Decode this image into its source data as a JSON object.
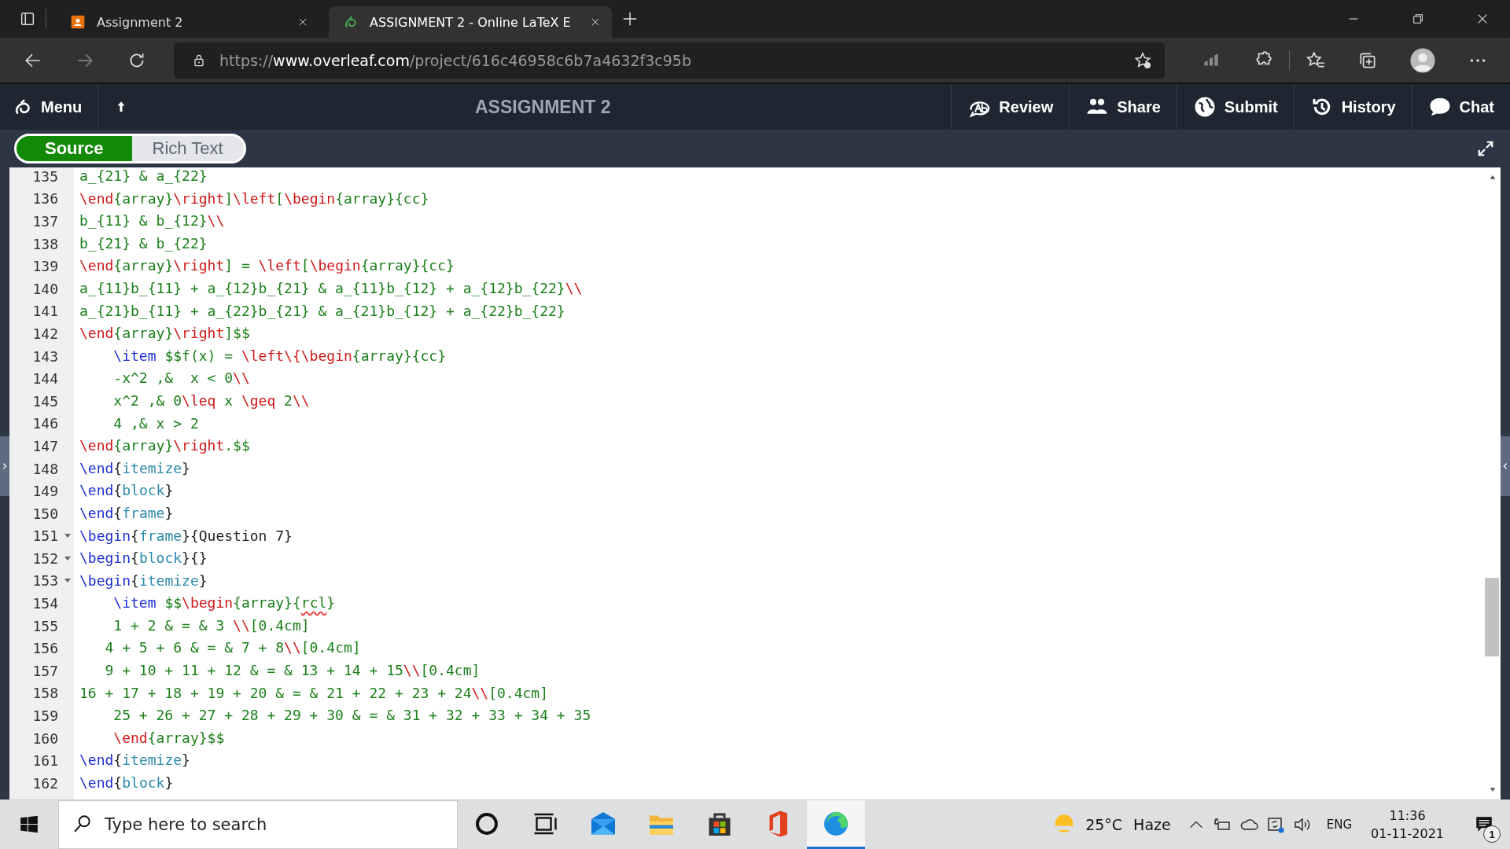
{
  "browser": {
    "tabs": [
      {
        "title": "Assignment 2",
        "kind": "classroom",
        "selected": false
      },
      {
        "title": "ASSIGNMENT 2 - Online LaTeX E",
        "kind": "overleaf",
        "selected": true
      }
    ],
    "url": {
      "scheme": "https://",
      "domain": "www.overleaf.com",
      "path": "/project/616c46958c6b7a4632f3c95b"
    }
  },
  "toolbar": {
    "menu": "Menu",
    "title": "ASSIGNMENT 2",
    "actions": [
      {
        "label": "Review",
        "kind": "review"
      },
      {
        "label": "Share",
        "kind": "share"
      },
      {
        "label": "Submit",
        "kind": "submit"
      },
      {
        "label": "History",
        "kind": "history"
      },
      {
        "label": "Chat",
        "kind": "chat"
      }
    ]
  },
  "editor_modes": [
    {
      "label": "Source",
      "selected": true
    },
    {
      "label": "Rich Text",
      "selected": false
    }
  ],
  "code_lines": [
    {
      "number": "135",
      "fold": false,
      "tokens": [
        {
          "kind": "math",
          "text": "a_{21} & a_{22}"
        }
      ]
    },
    {
      "number": "136",
      "fold": false,
      "tokens": [
        {
          "kind": "cmd",
          "text": "\\end"
        },
        {
          "kind": "math",
          "text": "{array}"
        },
        {
          "kind": "cmd",
          "text": "\\right"
        },
        {
          "kind": "math",
          "text": "]"
        },
        {
          "kind": "cmd",
          "text": "\\left"
        },
        {
          "kind": "math",
          "text": "["
        },
        {
          "kind": "cmd",
          "text": "\\begin"
        },
        {
          "kind": "math",
          "text": "{array}{cc}"
        }
      ]
    },
    {
      "number": "137",
      "fold": false,
      "tokens": [
        {
          "kind": "math",
          "text": "b_{11} & b_{12}"
        },
        {
          "kind": "cmd",
          "text": "\\\\"
        }
      ]
    },
    {
      "number": "138",
      "fold": false,
      "tokens": [
        {
          "kind": "math",
          "text": "b_{21} & b_{22}"
        }
      ]
    },
    {
      "number": "139",
      "fold": false,
      "tokens": [
        {
          "kind": "cmd",
          "text": "\\end"
        },
        {
          "kind": "math",
          "text": "{array}"
        },
        {
          "kind": "cmd",
          "text": "\\right"
        },
        {
          "kind": "math",
          "text": "] = "
        },
        {
          "kind": "cmd",
          "text": "\\left"
        },
        {
          "kind": "math",
          "text": "["
        },
        {
          "kind": "cmd",
          "text": "\\begin"
        },
        {
          "kind": "math",
          "text": "{array}{cc}"
        }
      ]
    },
    {
      "number": "140",
      "fold": false,
      "tokens": [
        {
          "kind": "math",
          "text": "a_{11}b_{11} + a_{12}b_{21} & a_{11}b_{12} + a_{12}b_{22}"
        },
        {
          "kind": "cmd",
          "text": "\\\\"
        }
      ]
    },
    {
      "number": "141",
      "fold": false,
      "tokens": [
        {
          "kind": "math",
          "text": "a_{21}b_{11} + a_{22}b_{21} & a_{21}b_{12} + a_{22}b_{22}"
        }
      ]
    },
    {
      "number": "142",
      "fold": false,
      "tokens": [
        {
          "kind": "cmd",
          "text": "\\end"
        },
        {
          "kind": "math",
          "text": "{array}"
        },
        {
          "kind": "cmd",
          "text": "\\right"
        },
        {
          "kind": "math",
          "text": "]$$"
        }
      ]
    },
    {
      "number": "143",
      "fold": false,
      "tokens": [
        {
          "kind": "kw",
          "text": "    \\item"
        },
        {
          "kind": "math",
          "text": " $$f(x) = "
        },
        {
          "kind": "cmd",
          "text": "\\left\\{\\begin"
        },
        {
          "kind": "math",
          "text": "{array}{cc}"
        }
      ]
    },
    {
      "number": "144",
      "fold": false,
      "tokens": [
        {
          "kind": "math",
          "text": "    -x^2 ,&  x < 0"
        },
        {
          "kind": "cmd",
          "text": "\\\\"
        }
      ]
    },
    {
      "number": "145",
      "fold": false,
      "tokens": [
        {
          "kind": "math",
          "text": "    x^2 ,& 0"
        },
        {
          "kind": "cmd",
          "text": "\\leq"
        },
        {
          "kind": "math",
          "text": " x "
        },
        {
          "kind": "cmd",
          "text": "\\geq"
        },
        {
          "kind": "math",
          "text": " 2"
        },
        {
          "kind": "cmd",
          "text": "\\\\"
        }
      ]
    },
    {
      "number": "146",
      "fold": false,
      "tokens": [
        {
          "kind": "math",
          "text": "    4 ,& x > 2"
        }
      ]
    },
    {
      "number": "147",
      "fold": false,
      "tokens": [
        {
          "kind": "cmd",
          "text": "\\end"
        },
        {
          "kind": "math",
          "text": "{array}"
        },
        {
          "kind": "cmd",
          "text": "\\right"
        },
        {
          "kind": "math",
          "text": ".$$"
        }
      ]
    },
    {
      "number": "148",
      "fold": false,
      "tokens": [
        {
          "kind": "kw",
          "text": "\\end"
        },
        {
          "kind": "plain",
          "text": "{"
        },
        {
          "kind": "arg",
          "text": "itemize"
        },
        {
          "kind": "plain",
          "text": "}"
        }
      ]
    },
    {
      "number": "149",
      "fold": false,
      "tokens": [
        {
          "kind": "kw",
          "text": "\\end"
        },
        {
          "kind": "plain",
          "text": "{"
        },
        {
          "kind": "arg",
          "text": "block"
        },
        {
          "kind": "plain",
          "text": "}"
        }
      ]
    },
    {
      "number": "150",
      "fold": false,
      "tokens": [
        {
          "kind": "kw",
          "text": "\\end"
        },
        {
          "kind": "plain",
          "text": "{"
        },
        {
          "kind": "arg",
          "text": "frame"
        },
        {
          "kind": "plain",
          "text": "}"
        }
      ]
    },
    {
      "number": "151",
      "fold": true,
      "tokens": [
        {
          "kind": "kw",
          "text": "\\begin"
        },
        {
          "kind": "plain",
          "text": "{"
        },
        {
          "kind": "arg",
          "text": "frame"
        },
        {
          "kind": "plain",
          "text": "}{Question 7}"
        }
      ]
    },
    {
      "number": "152",
      "fold": true,
      "tokens": [
        {
          "kind": "kw",
          "text": "\\begin"
        },
        {
          "kind": "plain",
          "text": "{"
        },
        {
          "kind": "arg",
          "text": "block"
        },
        {
          "kind": "plain",
          "text": "}{}"
        }
      ]
    },
    {
      "number": "153",
      "fold": true,
      "tokens": [
        {
          "kind": "kw",
          "text": "\\begin"
        },
        {
          "kind": "plain",
          "text": "{"
        },
        {
          "kind": "arg",
          "text": "itemize"
        },
        {
          "kind": "plain",
          "text": "}"
        }
      ]
    },
    {
      "number": "154",
      "fold": false,
      "tokens": [
        {
          "kind": "kw",
          "text": "    \\item"
        },
        {
          "kind": "math",
          "text": " $$"
        },
        {
          "kind": "cmd",
          "text": "\\begin"
        },
        {
          "kind": "math",
          "text": "{array}{"
        },
        {
          "kind": "spell",
          "text": "rcl"
        },
        {
          "kind": "math",
          "text": "}"
        }
      ]
    },
    {
      "number": "155",
      "fold": false,
      "tokens": [
        {
          "kind": "math",
          "text": "    1 + 2 & = & 3 "
        },
        {
          "kind": "cmd",
          "text": "\\\\"
        },
        {
          "kind": "math",
          "text": "[0.4cm]"
        }
      ]
    },
    {
      "number": "156",
      "fold": false,
      "tokens": [
        {
          "kind": "math",
          "text": "   4 + 5 + 6 & = & 7 + 8"
        },
        {
          "kind": "cmd",
          "text": "\\\\"
        },
        {
          "kind": "math",
          "text": "[0.4cm]"
        }
      ]
    },
    {
      "number": "157",
      "fold": false,
      "tokens": [
        {
          "kind": "math",
          "text": "   9 + 10 + 11 + 12 & = & 13 + 14 + 15"
        },
        {
          "kind": "cmd",
          "text": "\\\\"
        },
        {
          "kind": "math",
          "text": "[0.4cm]"
        }
      ]
    },
    {
      "number": "158",
      "fold": false,
      "tokens": [
        {
          "kind": "math",
          "text": "16 + 17 + 18 + 19 + 20 & = & 21 + 22 + 23 + 24"
        },
        {
          "kind": "cmd",
          "text": "\\\\"
        },
        {
          "kind": "math",
          "text": "[0.4cm]"
        }
      ]
    },
    {
      "number": "159",
      "fold": false,
      "tokens": [
        {
          "kind": "math",
          "text": "    25 + 26 + 27 + 28 + 29 + 30 & = & 31 + 32 + 33 + 34 + 35"
        }
      ]
    },
    {
      "number": "160",
      "fold": false,
      "tokens": [
        {
          "kind": "cmd",
          "text": "    \\end"
        },
        {
          "kind": "math",
          "text": "{array}$$"
        }
      ]
    },
    {
      "number": "161",
      "fold": false,
      "tokens": [
        {
          "kind": "kw",
          "text": "\\end"
        },
        {
          "kind": "plain",
          "text": "{"
        },
        {
          "kind": "arg",
          "text": "itemize"
        },
        {
          "kind": "plain",
          "text": "}"
        }
      ]
    },
    {
      "number": "162",
      "fold": false,
      "tokens": [
        {
          "kind": "kw",
          "text": "\\end"
        },
        {
          "kind": "plain",
          "text": "{"
        },
        {
          "kind": "arg",
          "text": "block"
        },
        {
          "kind": "plain",
          "text": "}"
        }
      ]
    }
  ],
  "taskbar": {
    "search": {
      "placeholder": "Type here to search"
    },
    "apps": [
      {
        "kind": "cortana",
        "active": false
      },
      {
        "kind": "taskview",
        "active": false
      },
      {
        "kind": "mail",
        "active": false
      },
      {
        "kind": "explorer",
        "active": false
      },
      {
        "kind": "store",
        "active": false
      },
      {
        "kind": "office",
        "active": false
      },
      {
        "kind": "edge",
        "active": true
      }
    ],
    "weather": {
      "temperature": "25°C",
      "condition": "Haze"
    },
    "language": "ENG",
    "time": "11:36",
    "date": "01-11-2021",
    "notifications": "1"
  }
}
